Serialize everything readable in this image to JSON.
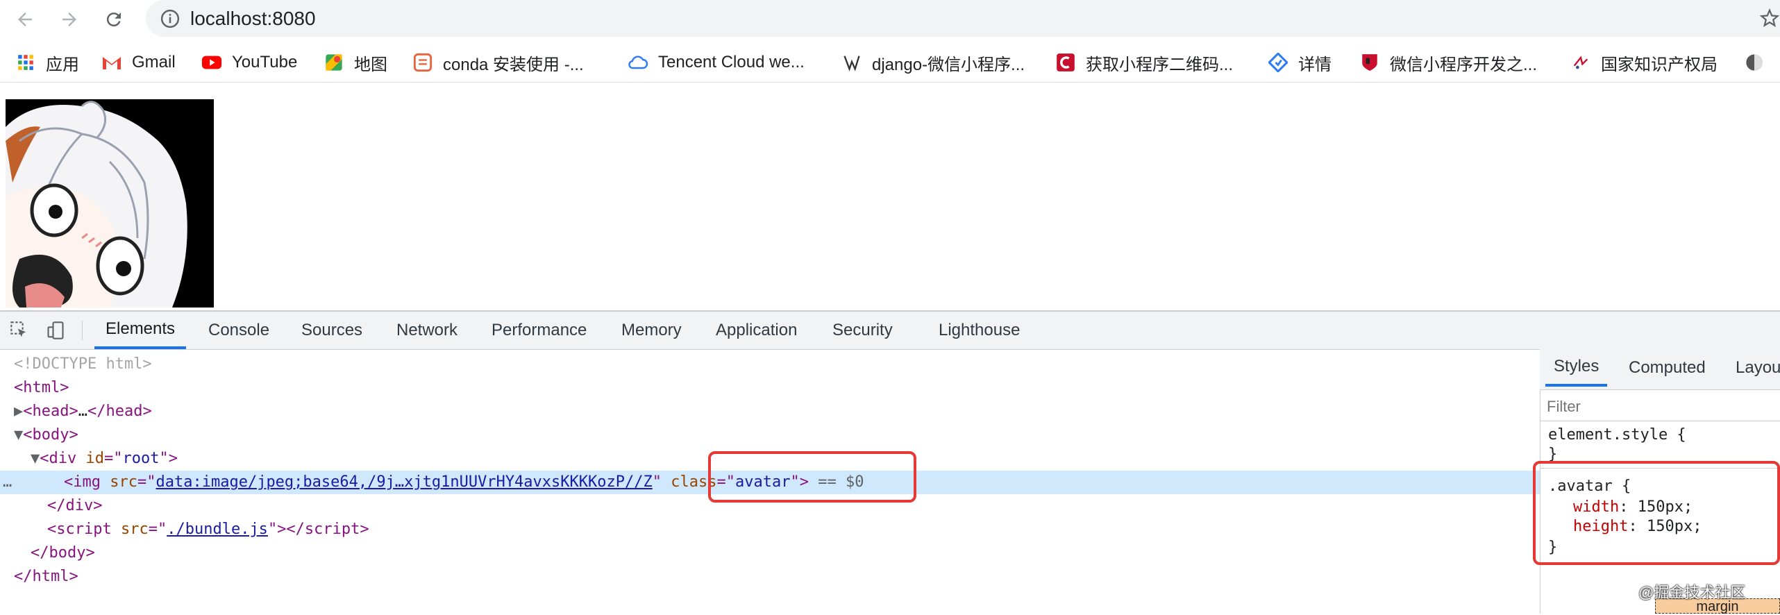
{
  "browser": {
    "url": "localhost:8080",
    "bookmarks": [
      {
        "label": "应用",
        "icon": "apps-grid-icon"
      },
      {
        "label": "Gmail",
        "icon": "gmail-icon"
      },
      {
        "label": "YouTube",
        "icon": "youtube-icon"
      },
      {
        "label": "地图",
        "icon": "maps-icon"
      },
      {
        "label": "conda 安装使用 -...",
        "icon": "bookmark-favicon"
      },
      {
        "label": "Tencent Cloud we...",
        "icon": "cloud-icon"
      },
      {
        "label": "django-微信小程序...",
        "icon": "bookmark-favicon"
      },
      {
        "label": "获取小程序二维码...",
        "icon": "bookmark-favicon"
      },
      {
        "label": "详情",
        "icon": "bookmark-favicon"
      },
      {
        "label": "微信小程序开发之...",
        "icon": "bookmark-favicon"
      },
      {
        "label": "国家知识产权局",
        "icon": "bookmark-favicon"
      }
    ]
  },
  "devtools": {
    "tabs": [
      "Elements",
      "Console",
      "Sources",
      "Network",
      "Performance",
      "Memory",
      "Application",
      "Security",
      "Lighthouse"
    ],
    "active_tab": "Elements",
    "dom": {
      "doctype": "<!DOCTYPE html>",
      "html_open": "html",
      "head": "head",
      "head_ellipsis": "…",
      "body": "body",
      "div": "div",
      "div_attr": "id",
      "div_val": "root",
      "img": "img",
      "img_src_attr": "src",
      "img_src_val": "data:image/jpeg;base64,/9j…xjtg1nUUVrHY4avxsKKKKozP//Z",
      "img_class_attr": "class",
      "img_class_val": "avatar",
      "selected_marker": "== $0",
      "script": "script",
      "script_src_val": "./bundle.js"
    },
    "styles": {
      "tabs": [
        "Styles",
        "Computed",
        "Layou"
      ],
      "filter_placeholder": "Filter",
      "element_style": "element.style {",
      "close_brace": "}",
      "selector": ".avatar {",
      "props": [
        {
          "name": "width",
          "value": "150px;"
        },
        {
          "name": "height",
          "value": "150px;"
        }
      ],
      "box_model_label": "margin"
    }
  },
  "watermark": "@掘金技术社区",
  "colors": {
    "accent": "#1a73e8",
    "highlight_box": "#e53935",
    "selected_row": "#cfe8fc"
  }
}
